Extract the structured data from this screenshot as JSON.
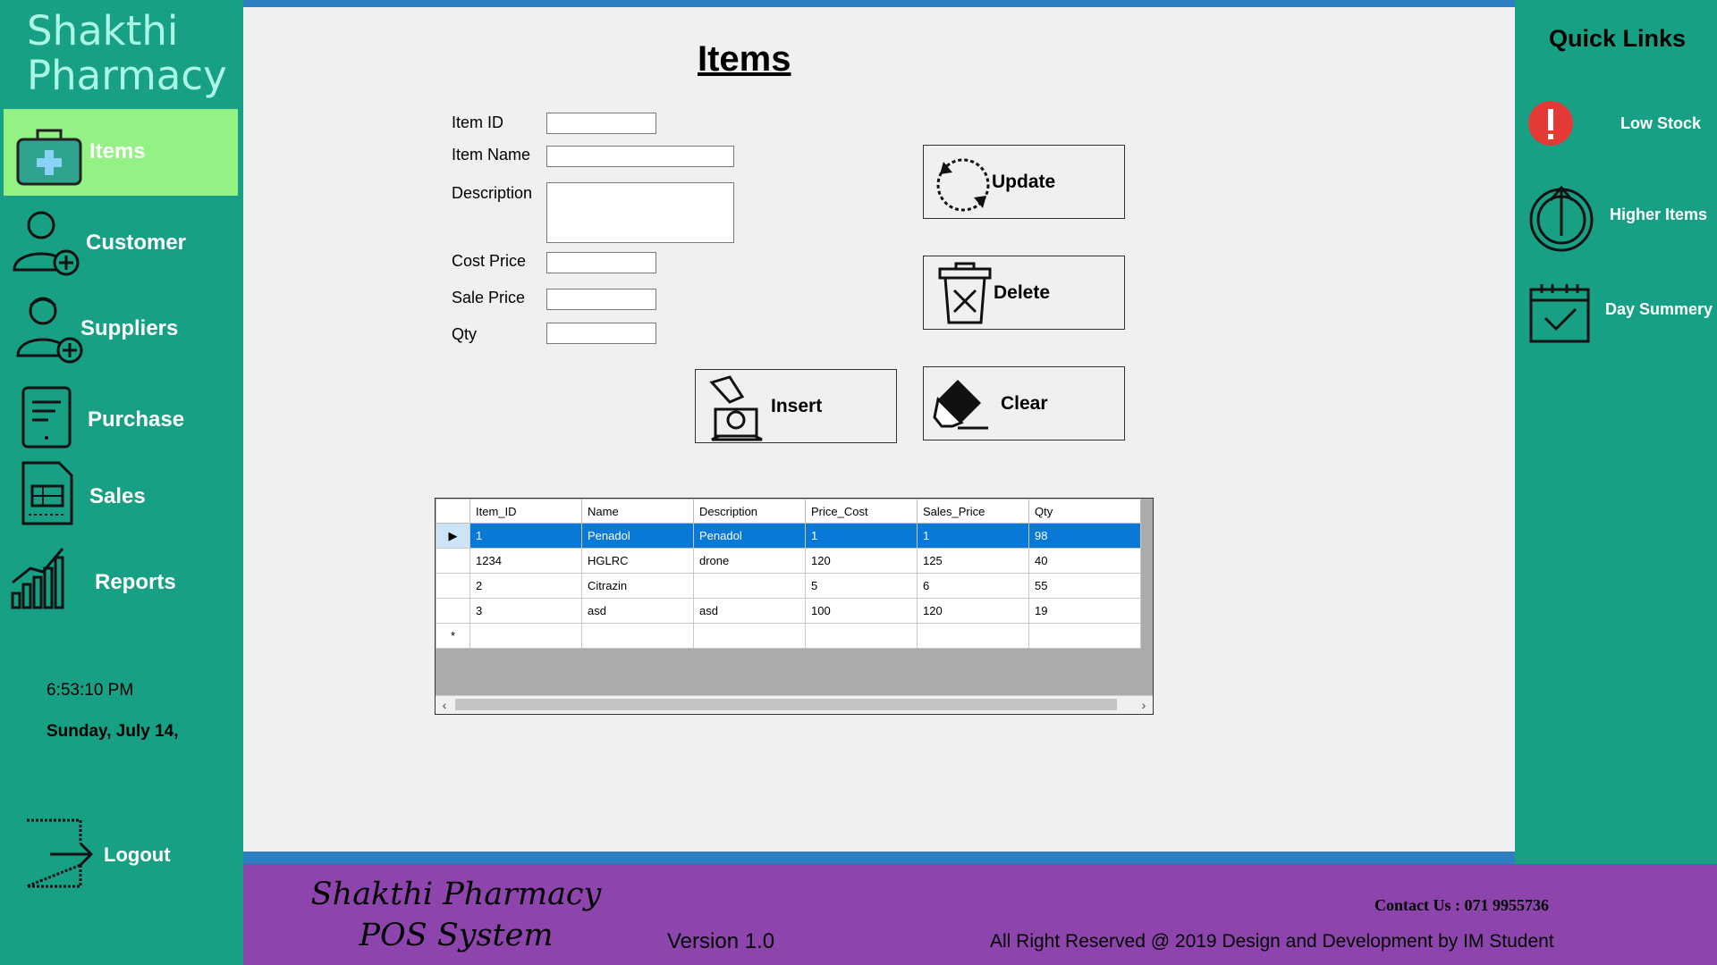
{
  "app": {
    "brand_line1": "Shakthi",
    "brand_line2": "Pharmacy"
  },
  "sidebar": {
    "items": [
      {
        "label": "Items",
        "icon": "medical-kit-icon",
        "active": true
      },
      {
        "label": "Customer",
        "icon": "customer-add-icon"
      },
      {
        "label": "Suppliers",
        "icon": "supplier-add-icon"
      },
      {
        "label": "Purchase",
        "icon": "document-icon"
      },
      {
        "label": "Sales",
        "icon": "invoice-icon"
      },
      {
        "label": "Reports",
        "icon": "bar-chart-icon"
      }
    ],
    "time": "6:53:10 PM",
    "date": "Sunday, July 14,",
    "logout_label": "Logout"
  },
  "form": {
    "title": "Items",
    "fields": {
      "item_id": {
        "label": "Item ID",
        "value": ""
      },
      "item_name": {
        "label": "Item Name",
        "value": ""
      },
      "description": {
        "label": "Description",
        "value": ""
      },
      "cost_price": {
        "label": "Cost Price",
        "value": ""
      },
      "sale_price": {
        "label": "Sale Price",
        "value": ""
      },
      "qty": {
        "label": "Qty",
        "value": ""
      }
    },
    "buttons": {
      "update": "Update",
      "delete": "Delete",
      "insert": "Insert",
      "clear": "Clear"
    }
  },
  "grid": {
    "columns": [
      "Item_ID",
      "Name",
      "Description",
      "Price_Cost",
      "Sales_Price",
      "Qty"
    ],
    "rows": [
      [
        "1",
        "Penadol",
        "Penadol",
        "1",
        "1",
        "98"
      ],
      [
        "1234",
        "HGLRC",
        "drone",
        "120",
        "125",
        "40"
      ],
      [
        "2",
        "Citrazin",
        "",
        "5",
        "6",
        "55"
      ],
      [
        "3",
        "asd",
        "asd",
        "100",
        "120",
        "19"
      ]
    ],
    "selected_row": 0,
    "new_row_marker": "*",
    "current_row_marker": "▶"
  },
  "quick_links": {
    "title": "Quick Links",
    "items": [
      {
        "label": "Low Stock",
        "icon": "alert-icon"
      },
      {
        "label": "Higher Items",
        "icon": "arrow-up-circle-icon"
      },
      {
        "label": "Day Summery",
        "icon": "calendar-check-icon"
      }
    ]
  },
  "footer": {
    "title_line1": "Shakthi Pharmacy",
    "title_line2": "POS System",
    "version": "Version 1.0",
    "contact": "Contact Us : 071 9955736",
    "rights": "All Right Reserved @ 2019 Design and Development by IM Student"
  },
  "colors": {
    "sidebar": "#18a085",
    "active_nav": "#93f283",
    "footer": "#8e44ad",
    "accent_blue": "#2d7fc1",
    "selection": "#0a78d7",
    "alert_red": "#e53935"
  }
}
